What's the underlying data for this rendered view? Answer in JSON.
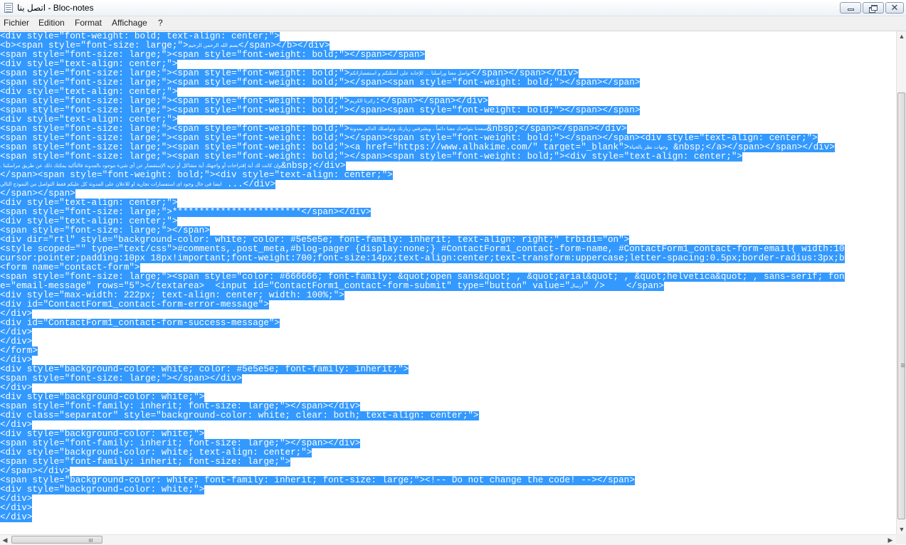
{
  "window": {
    "title": "اتصل بنا - Bloc-notes",
    "minimize_label": "",
    "maximize_label": "",
    "close_label": "✕"
  },
  "menu": [
    {
      "label": "Fichier"
    },
    {
      "label": "Edition"
    },
    {
      "label": "Format"
    },
    {
      "label": "Affichage"
    },
    {
      "label": "?"
    }
  ],
  "editor": {
    "selection_color": "#3399ff",
    "selected_text_color": "#ffffff",
    "lines": [
      [
        "<div style=\"font-weight: bold; text-align: center;\">"
      ],
      [
        "<b><span style=\"font-size: large;\">",
        {
          "ar": "بسم الله الرحمن الرحيم"
        },
        "</span></b></div>"
      ],
      [
        "<span style=\"font-size: large;\"><span style=\"font-weight: bold;\"></span></span>"
      ],
      [
        "<div style=\"text-align: center;\">"
      ],
      [
        "<span style=\"font-size: large;\"><span style=\"font-weight: bold;\">",
        {
          "ar": "تواصل معنا وراسلنا ... للإجابة على أسئلتكم و استفساراتكم"
        },
        "</span></span></div>"
      ],
      [
        "<span style=\"font-size: large;\"><span style=\"font-weight: bold;\"></span><span style=\"font-weight: bold;\"></span></span>"
      ],
      [
        "<div style=\"text-align: center;\">"
      ],
      [
        "<span style=\"font-size: large;\"><span style=\"font-weight: bold;\">",
        {
          "ar": "زائرنا الكريم"
        },
        ":</span></span></div>"
      ],
      [
        "<span style=\"font-size: large;\"><span style=\"font-weight: bold;\"></span><span style=\"font-weight: bold;\"></span></span>"
      ],
      [
        "<div style=\"text-align: center;\">"
      ],
      [
        "<span style=\"font-size: large;\"><span style=\"font-weight: bold;\">",
        {
          "ar": "سعدنا بتواجدك معنا دائماً ، ويشرفني زيارتك وتواصلك الدائم بمدونة"
        },
        "&nbsp;</span></span></div>"
      ],
      [
        "<span style=\"font-size: large;\"><span style=\"font-weight: bold;\"></span><span style=\"font-weight: bold;\"></span></span><div style=\"text-align: center;\">"
      ],
      [
        "<span style=\"font-size: large;\"><span style=\"font-weight: bold;\"><a href=\"https://www.alhakime.com/\" target=\"_blank\">",
        {
          "ar": "وجهات نظر بالحياة"
        },
        " &nbsp;</a></span></span></div>"
      ],
      [
        "<span style=\"font-size: large;\"><span style=\"font-weight: bold;\"></span><span style=\"font-weight: bold;\"><div style=\"text-align: center;\">"
      ],
      [
        {
          "ar": "وإن كانت لك أية إقتراحات أو واجهتك أية مشاكل أو تريد الإستفسار عن أي شيء موجود بالمدونة فالتأكيد يمكنك ذلك عن طريق مراسلتنا ."
        },
        "&nbsp;</div>"
      ],
      [
        "</span><span style=\"font-weight: bold;\"><div style=\"text-align: center;\">"
      ],
      [
        {
          "ar": "ايضا فى حال وجود اى استفسارات تجارية او للاعلان على المدونة كل عليكم فقط التواصل من النموذج التالي"
        },
        " ...</div>"
      ],
      [
        "</span></span>"
      ],
      [
        "<div style=\"text-align: center;\">"
      ],
      [
        "<span style=\"font-size: large;\">************************</span></div>"
      ],
      [
        "<div style=\"text-align: center;\">"
      ],
      [
        "<span style=\"font-size: large;\"></span>"
      ],
      [
        "<div dir=\"rtl\" style=\"background-color: white; color: #5e5e5e; font-family: inherit; text-align: right;\" trbidi=\"on\">"
      ],
      [
        "<style scoped=\"\" type=\"text/css\">#comments,.post_meta,#blog-pager {display:none;} #ContactForm1_contact-form-name, #ContactForm1_contact-form-email{ width:10"
      ],
      [
        "cursor:pointer;padding:10px 18px!important;font-weight:700;font-size:14px;text-align:center;text-transform:uppercase;letter-spacing:0.5px;border-radius:3px;b"
      ],
      [
        "<form name=\"contact-form\">"
      ],
      [
        "<span style=\"font-size: large;\"><span style=\"color: #666666; font-family: &quot;open sans&quot; , &quot;arial&quot; , &quot;helvetica&quot; , sans-serif; fon"
      ],
      [
        "e=\"email-message\" rows=\"5\"></textarea>  <input id=\"ContactForm1_contact-form-submit\" type=\"button\" value=\"",
        {
          "ar": "ارسال"
        },
        "\" />    </span>"
      ],
      [
        "<div style=\"max-width: 222px; text-align: center; width: 100%;\">"
      ],
      [
        "<div id=\"ContactForm1_contact-form-error-message\">"
      ],
      [
        "</div>"
      ],
      [
        "<div id=\"ContactForm1_contact-form-success-message\">"
      ],
      [
        "</div>"
      ],
      [
        "</div>"
      ],
      [
        "</form>"
      ],
      [
        "</div>"
      ],
      [
        "<div style=\"background-color: white; color: #5e5e5e; font-family: inherit;\">"
      ],
      [
        "<span style=\"font-size: large;\"></span></div>"
      ],
      [
        "</div>"
      ],
      [
        "<div style=\"background-color: white;\">"
      ],
      [
        "<span style=\"font-family: inherit; font-size: large;\"></span></div>"
      ],
      [
        "<div class=\"separator\" style=\"background-color: white; clear: both; text-align: center;\">"
      ],
      [
        "</div>"
      ],
      [
        "<div style=\"background-color: white;\">"
      ],
      [
        "<span style=\"font-family: inherit; font-size: large;\"></span></div>"
      ],
      [
        "<div style=\"background-color: white; text-align: center;\">"
      ],
      [
        "<span style=\"font-family: inherit; font-size: large;\">"
      ],
      [
        "</span></div>"
      ],
      [
        "<span style=\"background-color: white; font-family: inherit; font-size: large;\"><!-- Do not change the code! --></span>"
      ],
      [
        "<div style=\"background-color: white;\">"
      ],
      [
        "</div>"
      ],
      [
        "</div>"
      ],
      [
        "</div>"
      ]
    ]
  },
  "scrollbars": {
    "up_icon": "▲",
    "down_icon": "▼",
    "left_icon": "◀",
    "right_icon": "▶"
  }
}
